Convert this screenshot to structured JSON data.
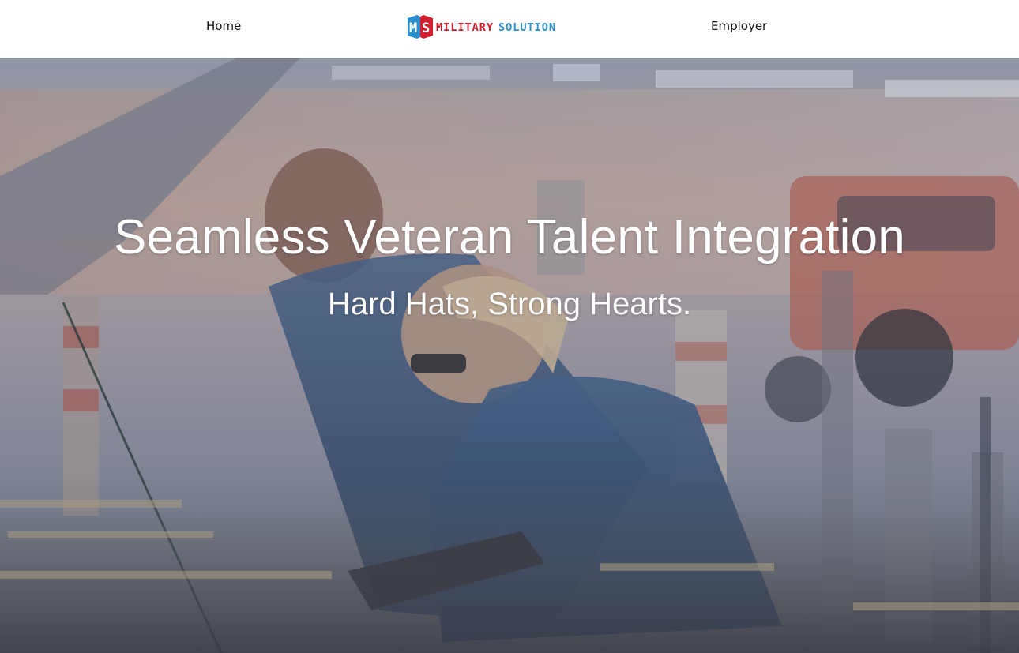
{
  "nav": {
    "home_label": "Home",
    "employer_label": "Employer"
  },
  "logo": {
    "mark_letters": "MS",
    "word1": "MILITARY",
    "word2": "SOLUTION",
    "icon": "ms-logo-icon",
    "colors": {
      "red": "#d21f2e",
      "blue": "#2a8fcf"
    }
  },
  "hero": {
    "title": "Seamless Veteran Talent Integration",
    "subtitle": "Hard Hats, Strong Hearts.",
    "background": "hero-background-image"
  }
}
